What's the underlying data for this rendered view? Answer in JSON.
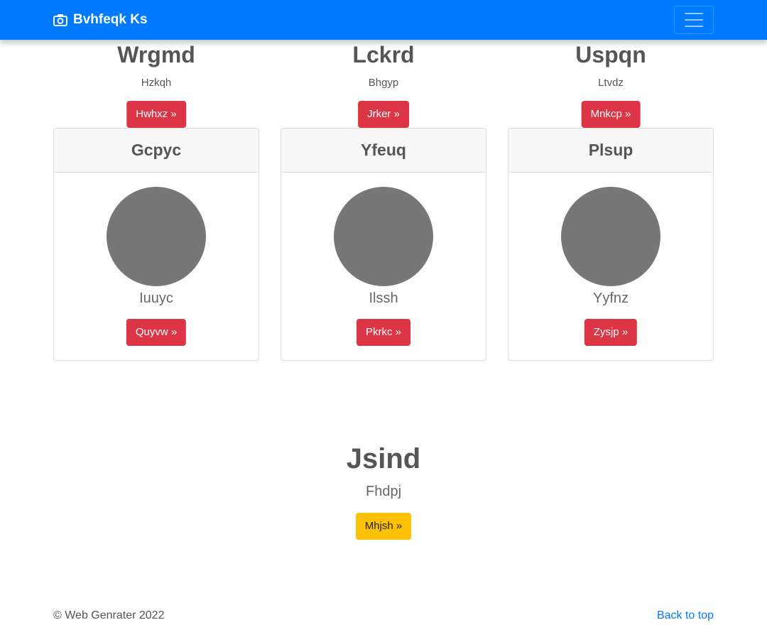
{
  "navbar": {
    "brand_icon": "camera-icon",
    "brand_text": "Bvhfeqk Ks",
    "toggler_icon": "hamburger-icon",
    "background": "#007bff"
  },
  "promos": [
    {
      "title": "Wrgmd",
      "text": "Hzkqh",
      "button": "Hwhxz »"
    },
    {
      "title": "Lckrd",
      "text": "Bhgyp",
      "button": "Jrker »"
    },
    {
      "title": "Uspqn",
      "text": "Ltvdz",
      "button": "Mnkcp »"
    }
  ],
  "cards": [
    {
      "header": "Gcpyc",
      "text": "Iuuyc",
      "button": "Quyvw »"
    },
    {
      "header": "Yfeuq",
      "text": "Ilssh",
      "button": "Pkrkc »"
    },
    {
      "header": "Plsup",
      "text": "Yyfnz",
      "button": "Zysjp »"
    }
  ],
  "hero": {
    "title": "Jsind",
    "text": "Fhdpj",
    "button": "Mhjsh »"
  },
  "footer": {
    "copyright": "© Web Genrater 2022",
    "back_to_top": "Back to top"
  },
  "colors": {
    "danger": "#dc3545",
    "warning": "#ffc107",
    "placeholder_circle": "#777777"
  }
}
